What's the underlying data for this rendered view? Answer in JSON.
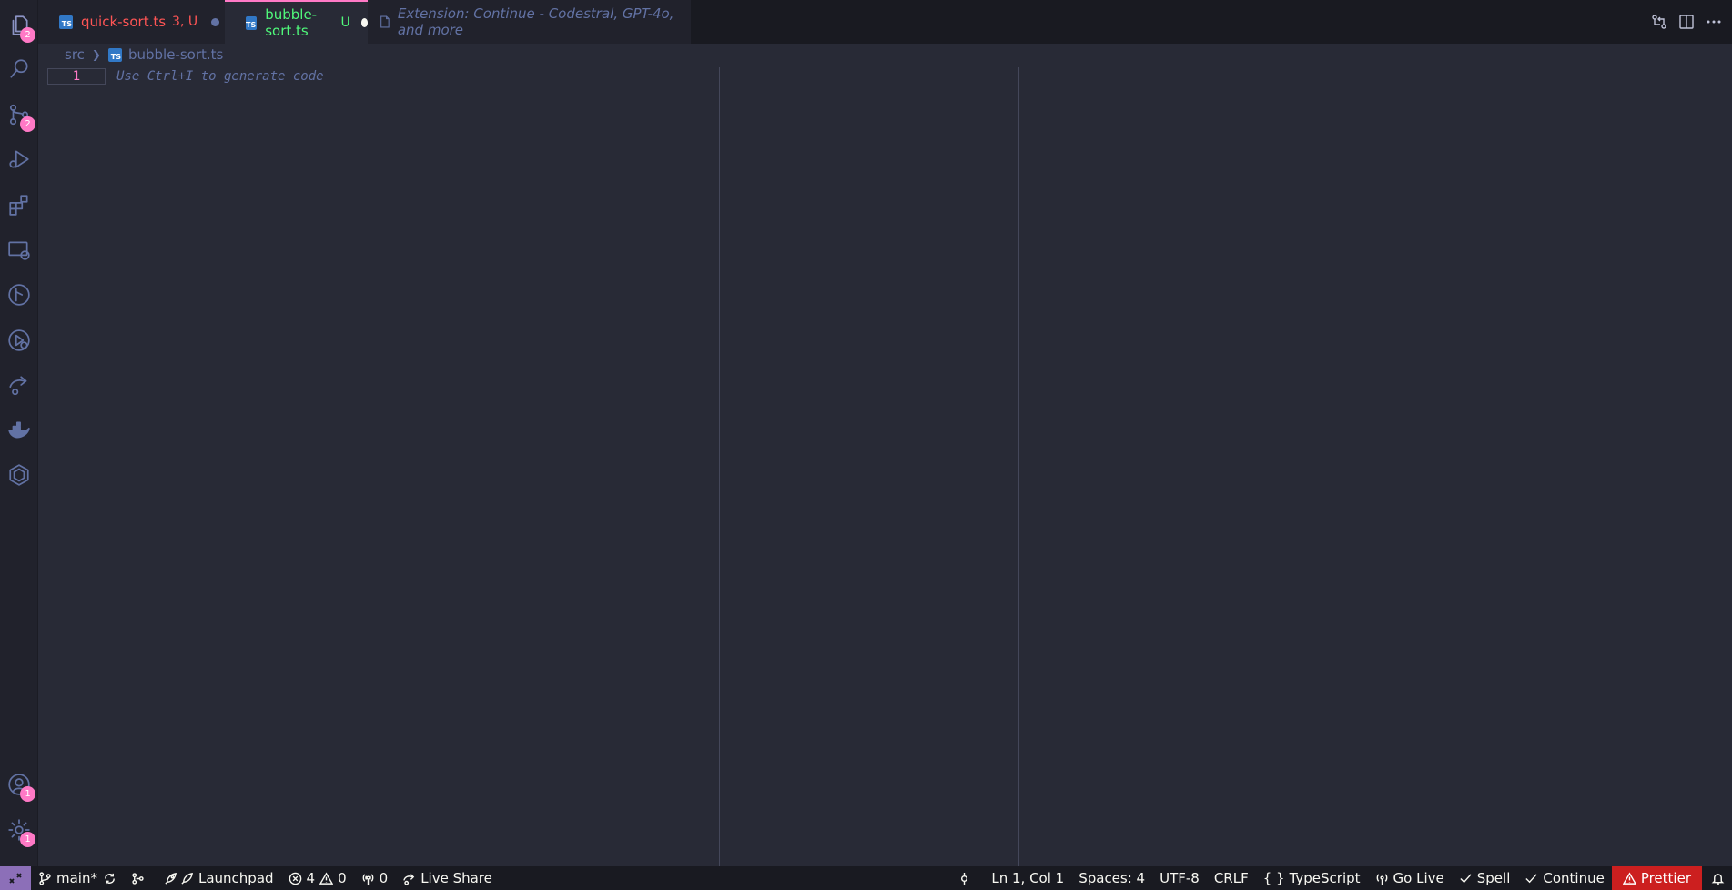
{
  "activity_bar": {
    "explorer_badge": "2",
    "scm_badge": "2",
    "accounts_badge": "1",
    "settings_badge": "1"
  },
  "tabs": [
    {
      "name": "quick-sort.ts",
      "state": "3, U",
      "icon": "TS"
    },
    {
      "name": "bubble-sort.ts",
      "state": "U",
      "icon": "TS"
    },
    {
      "name": "Extension: Continue - Codestral, GPT-4o, and more"
    }
  ],
  "breadcrumb": {
    "folder": "src",
    "file": "bubble-sort.ts",
    "file_icon": "TS"
  },
  "editor": {
    "line_number": "1",
    "placeholder": "Use Ctrl+I to generate code"
  },
  "status_bar": {
    "branch": "main*",
    "launchpad": "Launchpad",
    "errors": "4",
    "warnings": "0",
    "ports": "0",
    "live_share": "Live Share",
    "position": "Ln 1, Col 1",
    "spaces": "Spaces: 4",
    "encoding": "UTF-8",
    "eol": "CRLF",
    "language": "TypeScript",
    "go_live": "Go Live",
    "spell": "Spell",
    "continue": "Continue",
    "prettier": "Prettier"
  },
  "colors": {
    "accent": "#ff79c6",
    "error_tab": "#ff5555",
    "untracked_tab": "#50fa7b",
    "status_prettier": "#cc1f1f"
  }
}
